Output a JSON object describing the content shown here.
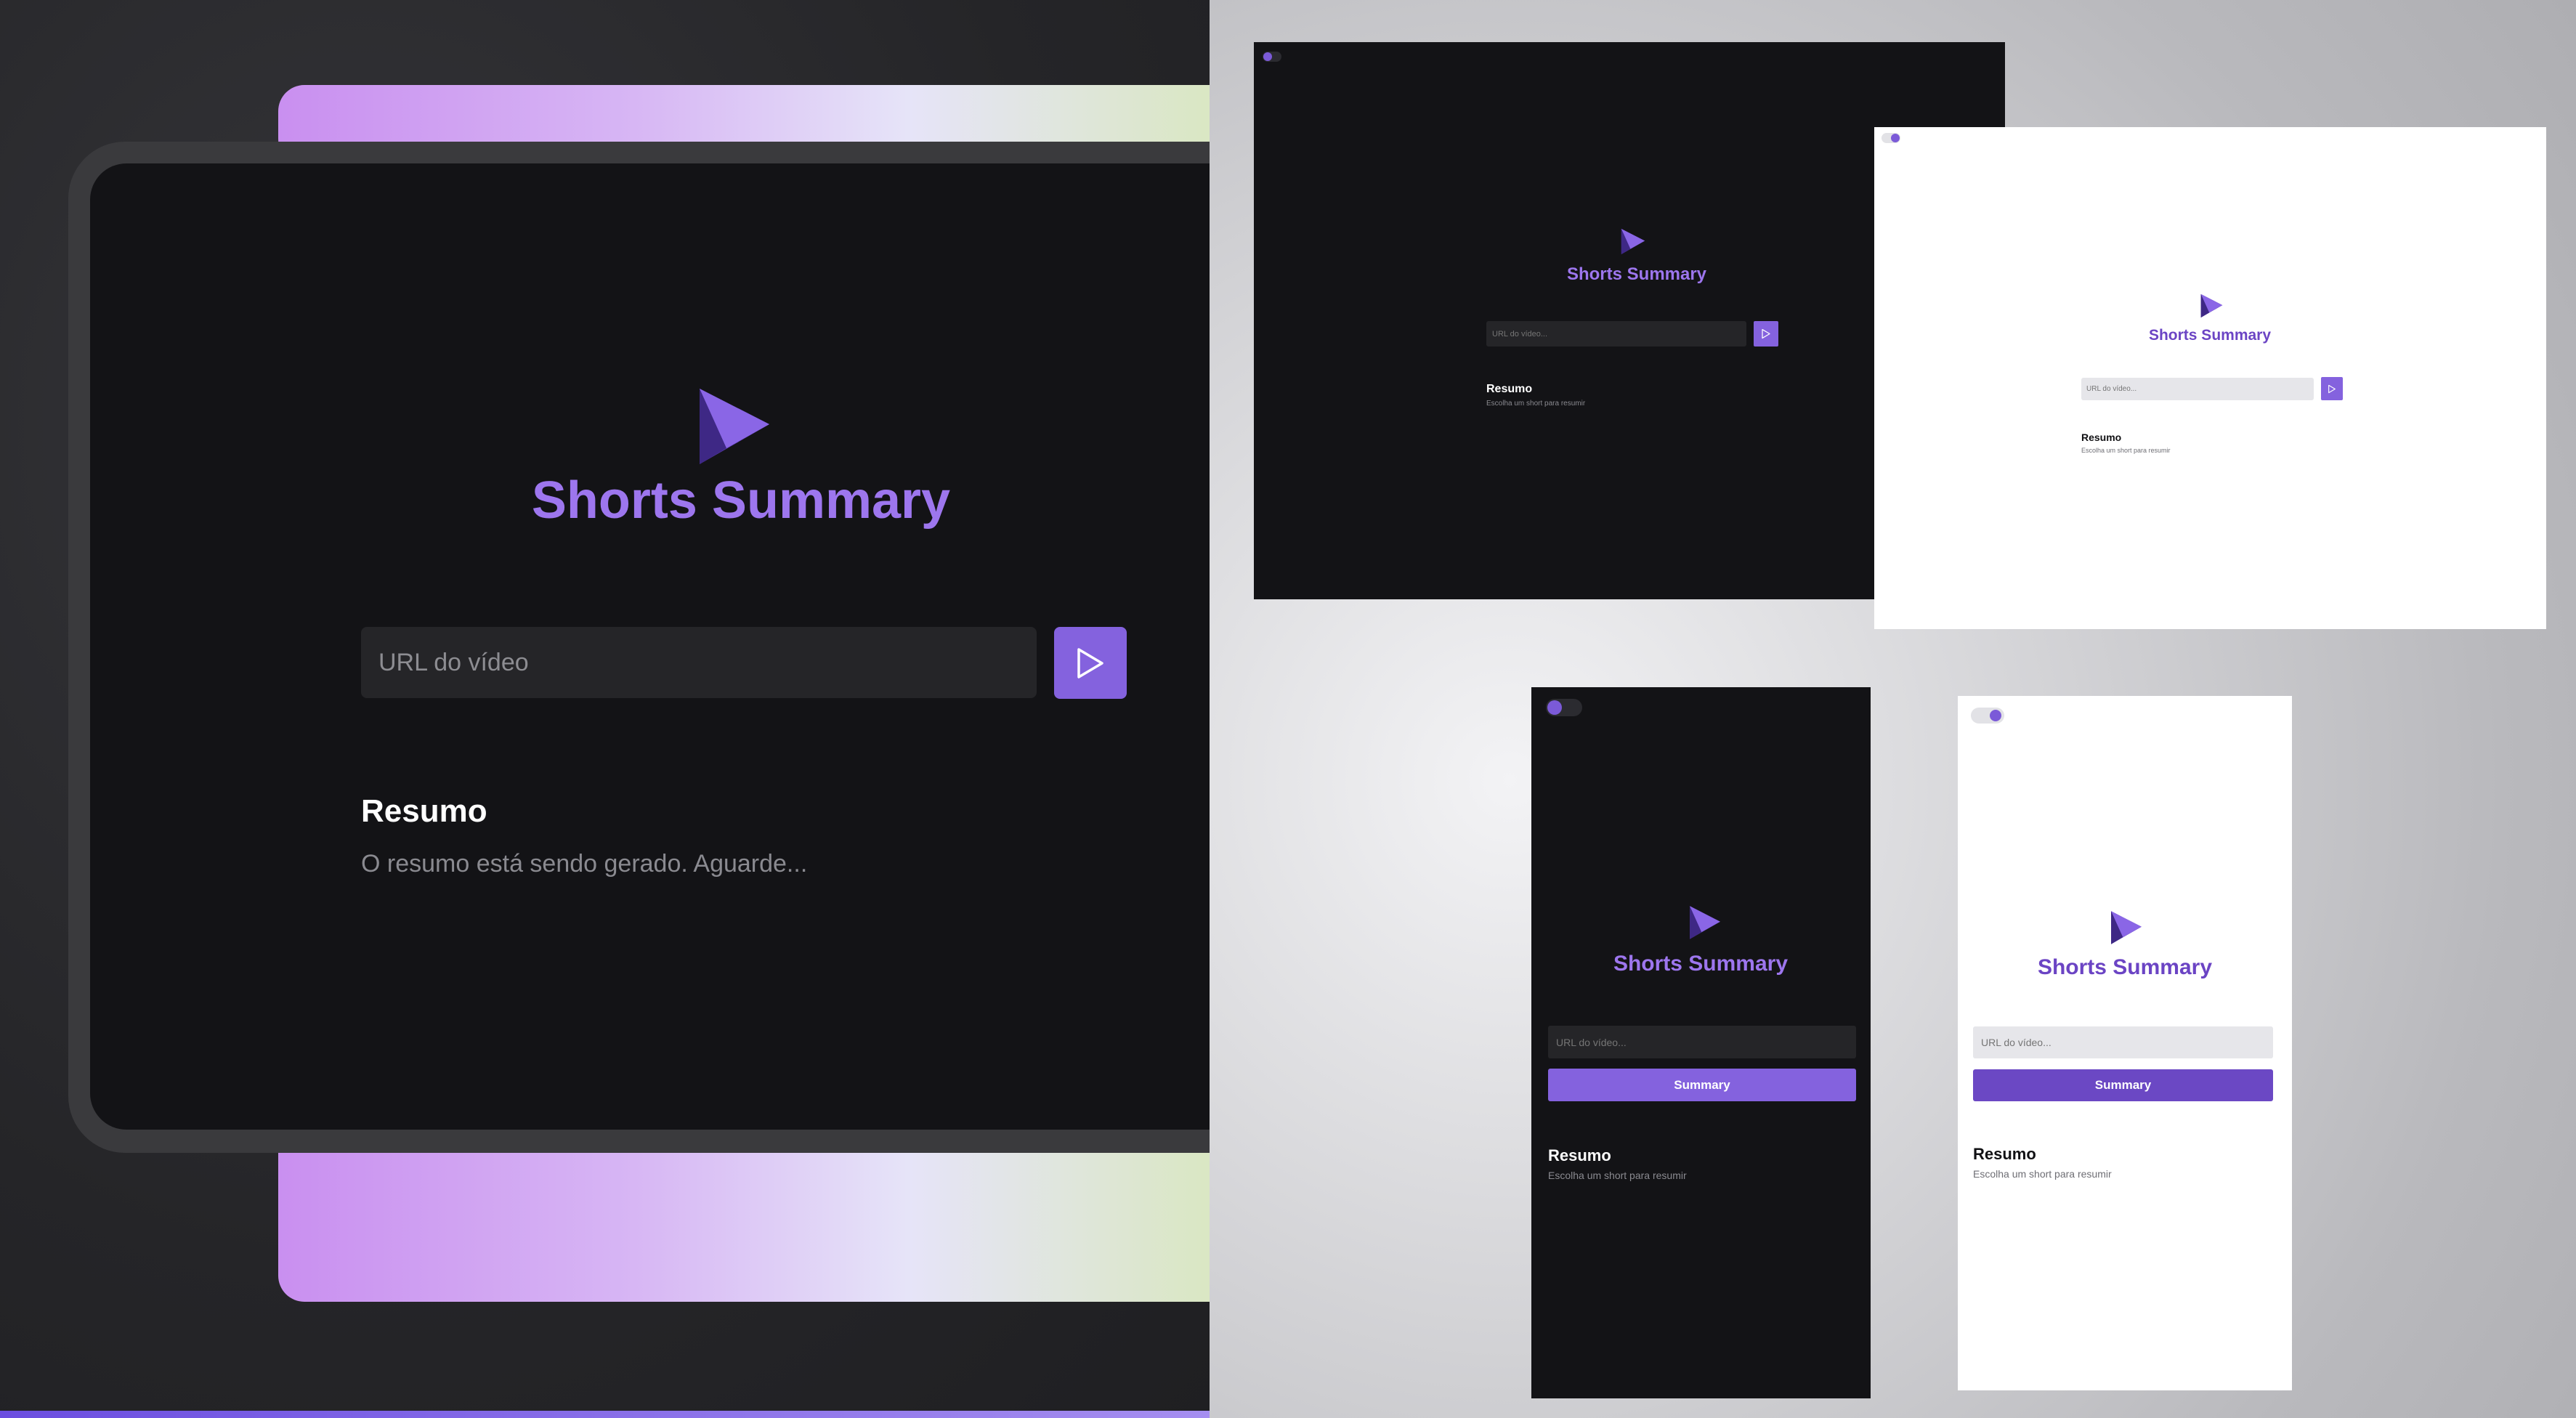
{
  "app": {
    "title": "Shorts Summary",
    "input_placeholder": "URL do vídeo",
    "input_placeholder_short": "URL do vídeo...",
    "send_button_icon": "play-outline-icon",
    "summary_button_label": "Summary",
    "resumo_heading": "Resumo",
    "status_generating": "O resumo está sendo gerado. Aguarde...",
    "status_empty": "Escolha um short para resumir"
  },
  "colors": {
    "accent": "#8462de",
    "accent_light": "#9d76ee",
    "accent_dark_title": "#6b44c4",
    "dark_bg": "#131316",
    "light_bg": "#ffffff"
  },
  "icons": {
    "logo": "play-logo-icon",
    "theme_toggle": "theme-toggle-icon"
  }
}
